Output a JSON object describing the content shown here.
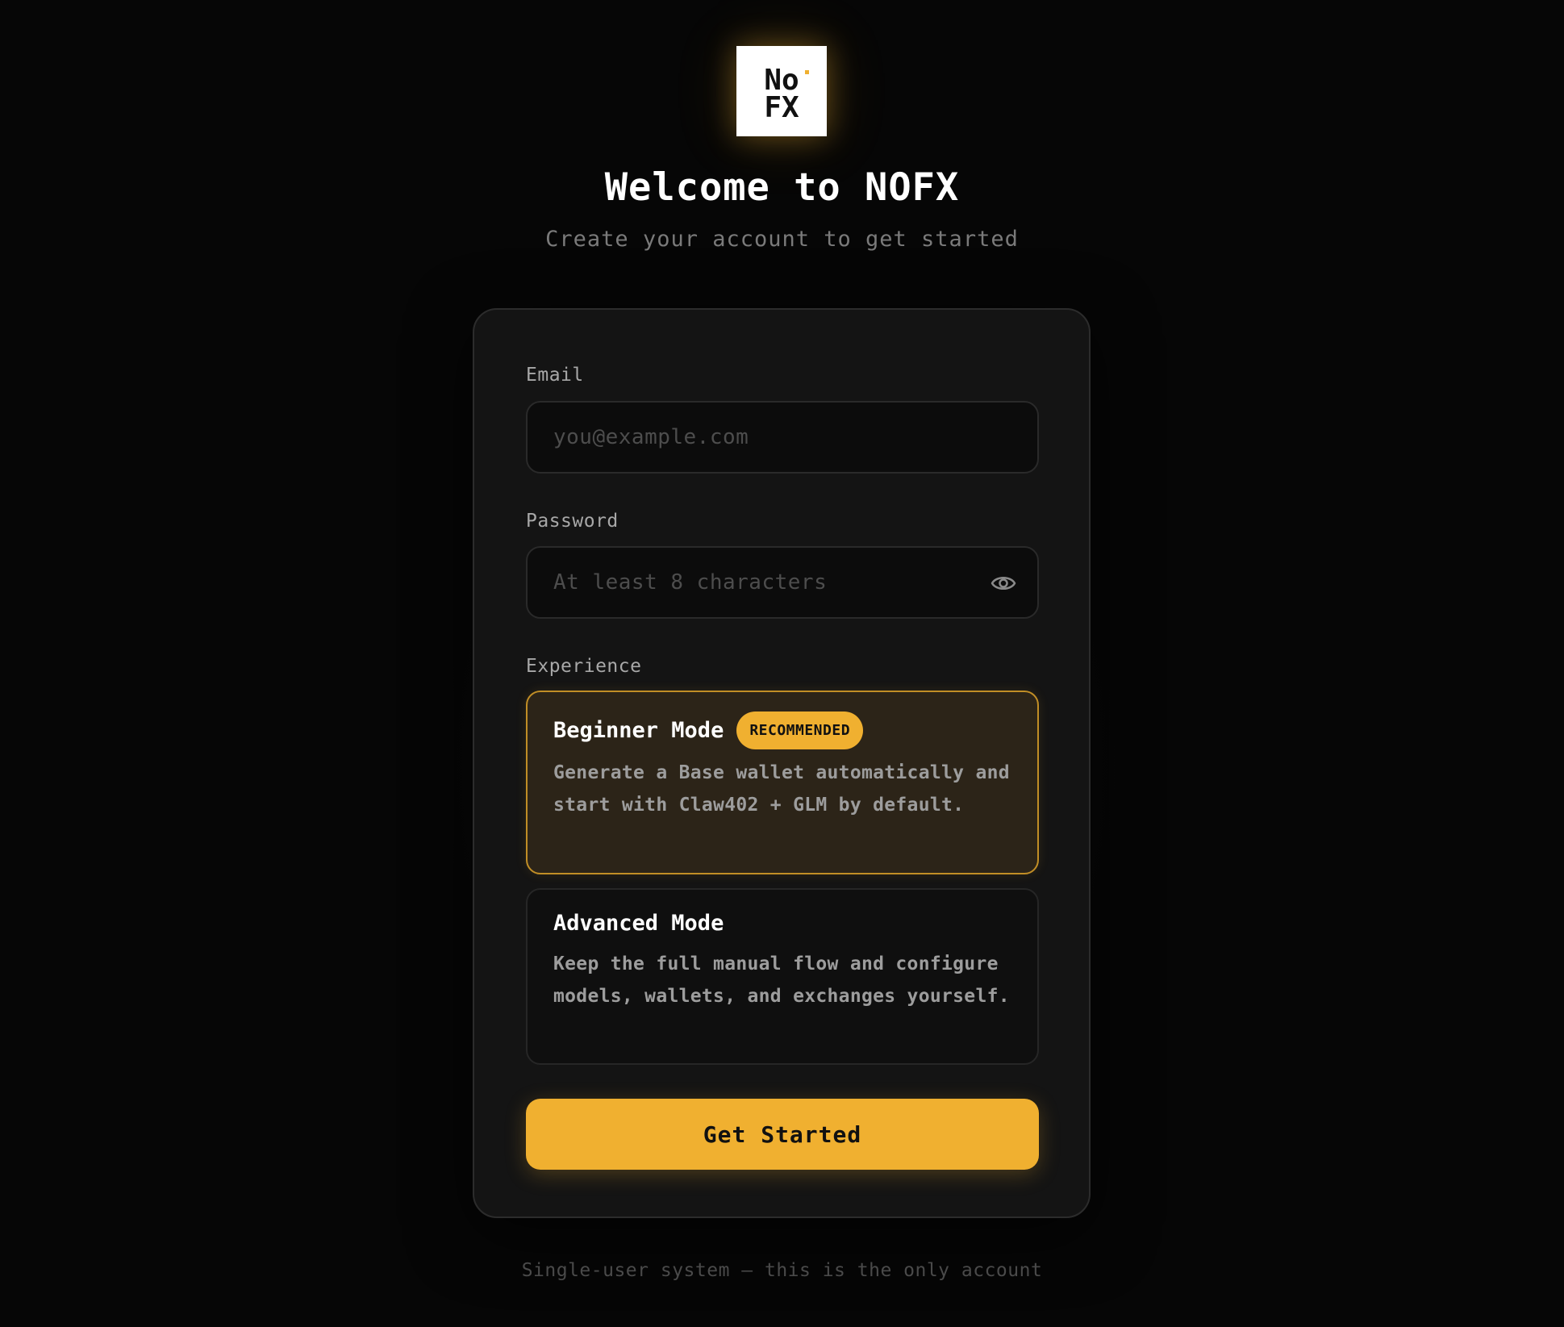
{
  "brand": {
    "logo_icon": "nofx-logo-icon",
    "logo_text_top": "No",
    "logo_text_bottom": "FX",
    "accent_color": "#f0b030"
  },
  "header": {
    "title": "Welcome to NOFX",
    "subtitle": "Create your account to get started"
  },
  "form": {
    "email": {
      "label": "Email",
      "placeholder": "you@example.com",
      "value": ""
    },
    "password": {
      "label": "Password",
      "placeholder": "At least 8 characters",
      "value": "",
      "toggle_icon": "eye-icon"
    },
    "experience": {
      "label": "Experience",
      "selected": "beginner",
      "options": [
        {
          "id": "beginner",
          "title": "Beginner Mode",
          "badge": "RECOMMENDED",
          "description": "Generate a Base wallet automatically and start with Claw402 + GLM by default."
        },
        {
          "id": "advanced",
          "title": "Advanced Mode",
          "description": "Keep the full manual flow and configure models, wallets, and exchanges yourself."
        }
      ]
    },
    "submit_label": "Get Started"
  },
  "footer": {
    "note": "Single-user system — this is the only account"
  }
}
